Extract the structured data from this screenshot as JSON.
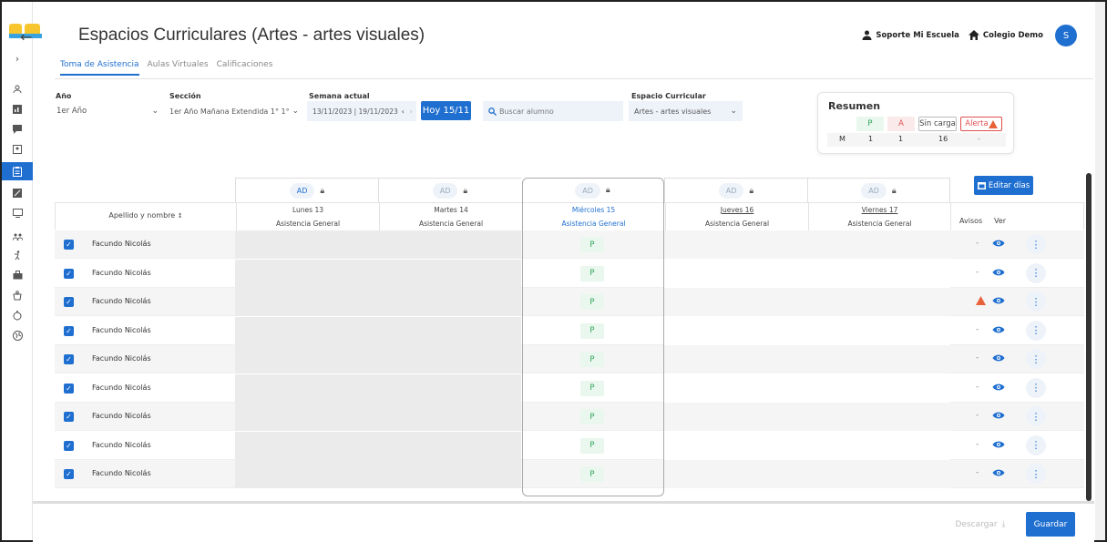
{
  "header": {
    "title": "Espacios Curriculares (Artes - artes visuales)",
    "user_label": "Soporte Mi Escuela",
    "school_label": "Colegio Demo",
    "avatar_initial": "S"
  },
  "tabs": [
    {
      "label": "Toma de Asistencia",
      "active": true
    },
    {
      "label": "Aulas Virtuales",
      "active": false
    },
    {
      "label": "Calificaciones",
      "active": false
    }
  ],
  "filters": {
    "anio_label": "Año",
    "anio_value": "1er Año",
    "seccion_label": "Sección",
    "seccion_value": "1er Año Mañana Extendida 1° 1°",
    "semana_label": "Semana actual",
    "semana_value": "13/11/2023 | 19/11/2023",
    "hoy_button": "Hoy 15/11",
    "search_placeholder": "Buscar alumno",
    "espacio_label": "Espacio Curricular",
    "espacio_value": "Artes - artes visuales"
  },
  "resumen": {
    "title": "Resumen",
    "p_label": "P",
    "a_label": "A",
    "sin_carga_label": "Sin carga",
    "alerta_label": "Alerta",
    "row_label": "M",
    "p_value": "1",
    "a_value": "1",
    "sin_carga_value": "16",
    "alerta_value": "-"
  },
  "editar_dias": "Editar días",
  "table": {
    "name_header": "Apellido y nombre",
    "avisos_header": "Avisos",
    "ver_header": "Ver",
    "days": [
      {
        "badge": "AD",
        "day": "Lunes 13",
        "type": "Asistencia General"
      },
      {
        "badge": "AD",
        "day": "Martes 14",
        "type": "Asistencia General"
      },
      {
        "badge": "AD",
        "day": "Miércoles 15",
        "type": "Asistencia General"
      },
      {
        "badge": "AD",
        "day": "Jueves 16",
        "type": "Asistencia General"
      },
      {
        "badge": "AD",
        "day": "Viernes 17",
        "type": "Asistencia General"
      }
    ],
    "rows": [
      {
        "name": "Facundo Nicolás",
        "wed": "P",
        "aviso": "-"
      },
      {
        "name": "Facundo Nicolás",
        "wed": "P",
        "aviso": "-"
      },
      {
        "name": "Facundo Nicolás",
        "wed": "P",
        "aviso": "alert"
      },
      {
        "name": "Facundo Nicolás",
        "wed": "P",
        "aviso": "-"
      },
      {
        "name": "Facundo Nicolás",
        "wed": "P",
        "aviso": "-"
      },
      {
        "name": "Facundo Nicolás",
        "wed": "P",
        "aviso": "-"
      },
      {
        "name": "Facundo Nicolás",
        "wed": "P",
        "aviso": "-"
      },
      {
        "name": "Facundo Nicolás",
        "wed": "P",
        "aviso": "-"
      },
      {
        "name": "Facundo Nicolás",
        "wed": "P",
        "aviso": "-"
      }
    ]
  },
  "footer": {
    "descargar": "Descargar",
    "guardar": "Guardar"
  },
  "colors": {
    "primary": "#1f6fd0",
    "present": "#2fa35a",
    "absent": "#e05050",
    "alert": "#e8623a"
  }
}
